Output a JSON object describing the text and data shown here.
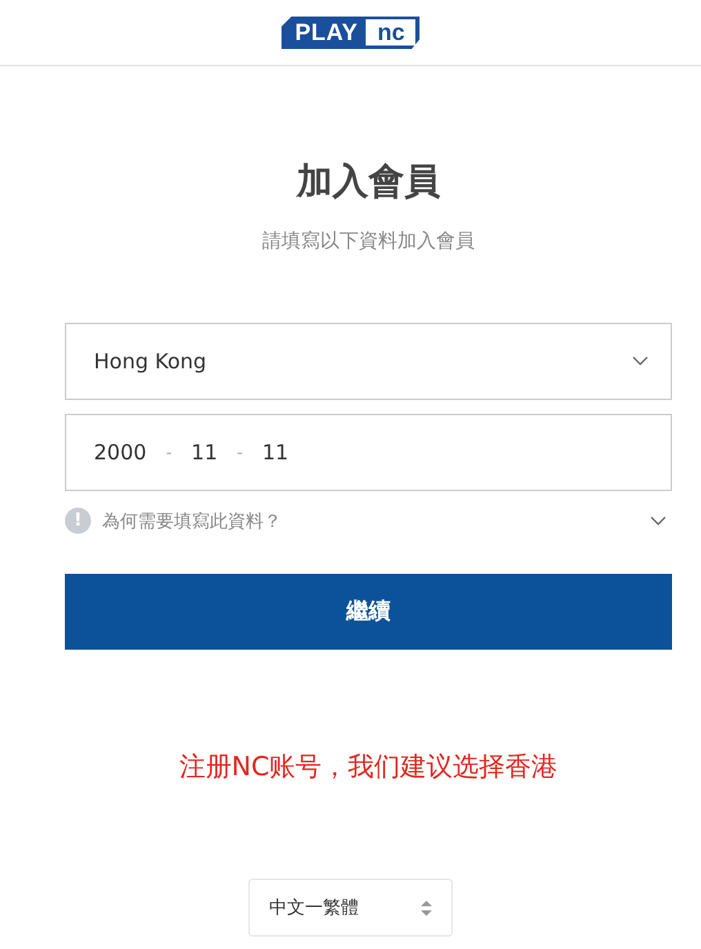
{
  "header": {
    "logo_left": "PLAY",
    "logo_right": "nc"
  },
  "title": "加入會員",
  "subtitle": "請填寫以下資料加入會員",
  "country": {
    "value": "Hong Kong"
  },
  "birthdate": {
    "year": "2000",
    "month": "11",
    "day": "11",
    "separator": "-"
  },
  "info": {
    "icon": "!",
    "text": "為何需要填寫此資料？",
    "expanded": false
  },
  "continue_button": "繼續",
  "notice": "注册NC账号，我们建议选择香港",
  "language": {
    "value": "中文一繁體"
  }
}
